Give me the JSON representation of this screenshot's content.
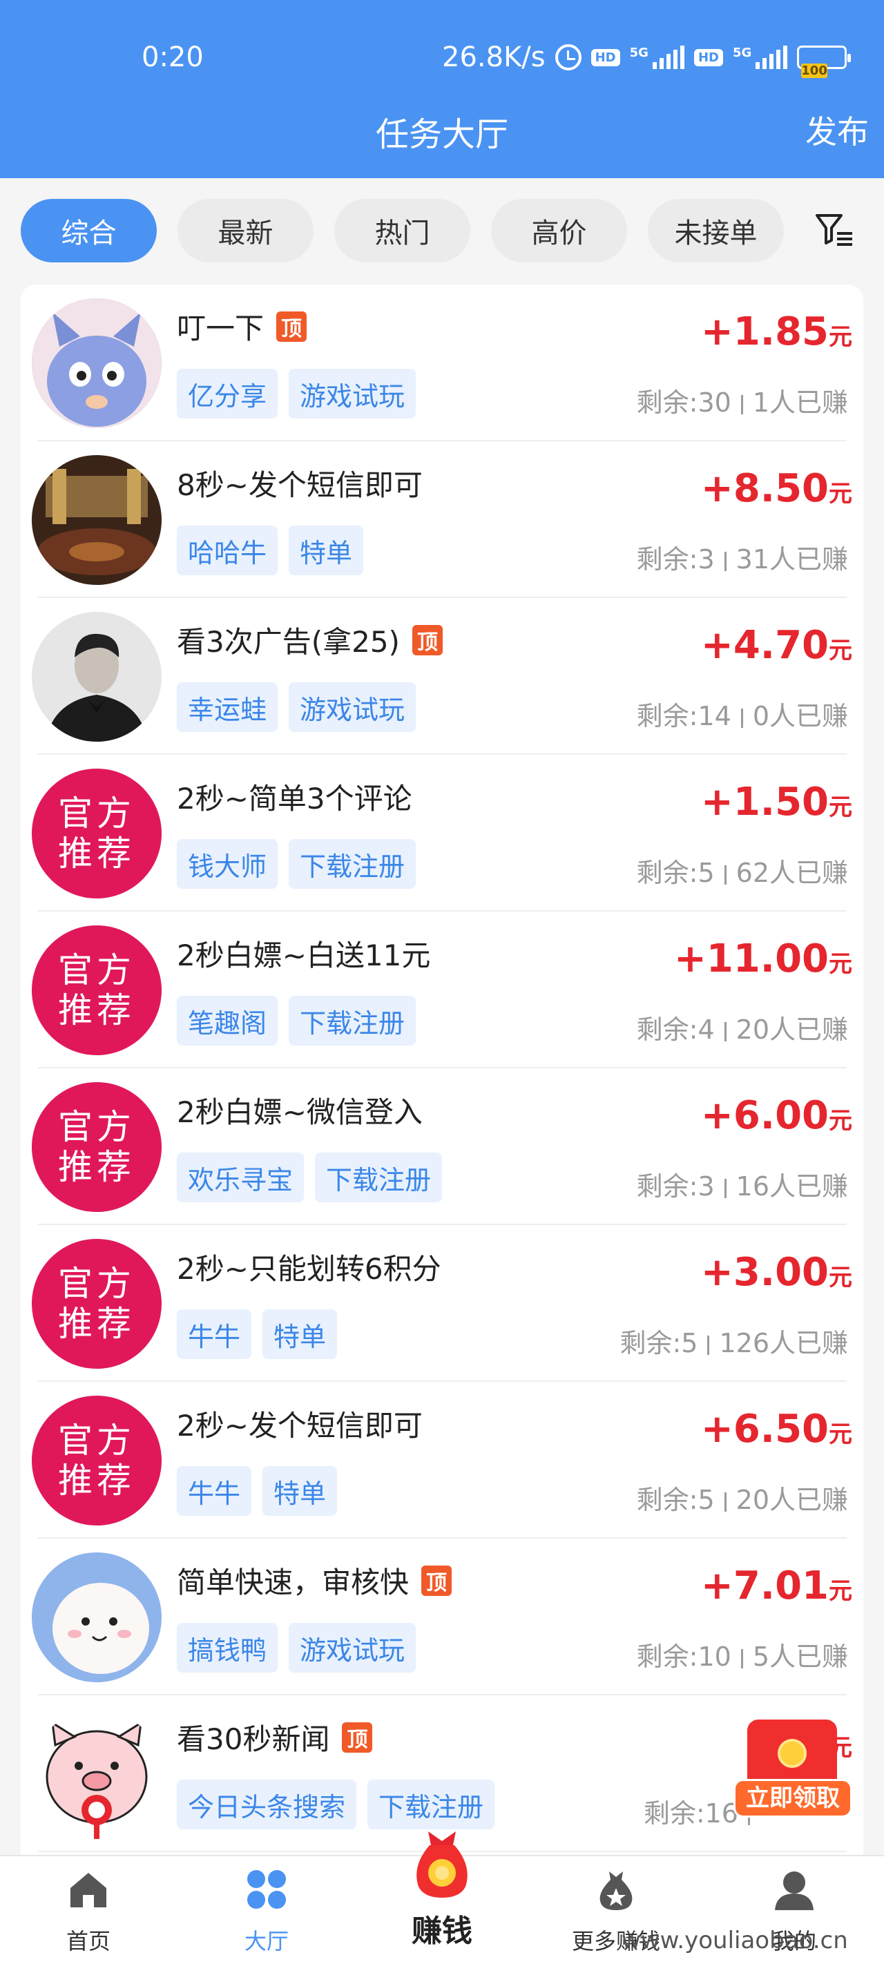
{
  "status_bar": {
    "time": "0:20",
    "speed": "26.8K/s",
    "battery": "100"
  },
  "header": {
    "title": "任务大厅",
    "publish_label": "发布"
  },
  "tabs": [
    {
      "label": "综合",
      "active": true
    },
    {
      "label": "最新",
      "active": false
    },
    {
      "label": "热门",
      "active": false
    },
    {
      "label": "高价",
      "active": false
    },
    {
      "label": "未接单",
      "active": false
    }
  ],
  "tasks": [
    {
      "title": "叮一下",
      "top": true,
      "tags": [
        "亿分享",
        "游戏试玩"
      ],
      "price": "+1.85",
      "unit": "元",
      "remain": "剩余:30",
      "earned": "1人已赚",
      "avatar": "rabbit-avatar"
    },
    {
      "title": "8秒~发个短信即可",
      "top": false,
      "tags": [
        "哈哈牛",
        "特单"
      ],
      "price": "+8.50",
      "unit": "元",
      "remain": "剩余:3",
      "earned": "31人已赚",
      "avatar": "palace-avatar"
    },
    {
      "title": "看3次广告(拿25)",
      "top": true,
      "tags": [
        "幸运蛙",
        "游戏试玩"
      ],
      "price": "+4.70",
      "unit": "元",
      "remain": "剩余:14",
      "earned": "0人已赚",
      "avatar": "man-avatar"
    },
    {
      "title": "2秒~简单3个评论",
      "top": false,
      "tags": [
        "钱大师",
        "下载注册"
      ],
      "price": "+1.50",
      "unit": "元",
      "remain": "剩余:5",
      "earned": "62人已赚",
      "avatar": "official"
    },
    {
      "title": "2秒白嫖~白送11元",
      "top": false,
      "tags": [
        "笔趣阁",
        "下载注册"
      ],
      "price": "+11.00",
      "unit": "元",
      "remain": "剩余:4",
      "earned": "20人已赚",
      "avatar": "official"
    },
    {
      "title": "2秒白嫖~微信登入",
      "top": false,
      "tags": [
        "欢乐寻宝",
        "下载注册"
      ],
      "price": "+6.00",
      "unit": "元",
      "remain": "剩余:3",
      "earned": "16人已赚",
      "avatar": "official"
    },
    {
      "title": "2秒~只能划转6积分",
      "top": false,
      "tags": [
        "牛牛",
        "特单"
      ],
      "price": "+3.00",
      "unit": "元",
      "remain": "剩余:5",
      "earned": "126人已赚",
      "avatar": "official"
    },
    {
      "title": "2秒~发个短信即可",
      "top": false,
      "tags": [
        "牛牛",
        "特单"
      ],
      "price": "+6.50",
      "unit": "元",
      "remain": "剩余:5",
      "earned": "20人已赚",
      "avatar": "official"
    },
    {
      "title": "简单快速，审核快",
      "top": true,
      "tags": [
        "搞钱鸭",
        "游戏试玩"
      ],
      "price": "+7.01",
      "unit": "元",
      "remain": "剩余:10",
      "earned": "5人已赚",
      "avatar": "dog-avatar"
    },
    {
      "title": "看30秒新闻",
      "top": true,
      "tags": [
        "今日头条搜索",
        "下载注册"
      ],
      "price": "+",
      "unit": "元",
      "remain": "剩余:16",
      "earned": "",
      "avatar": "pig-avatar"
    }
  ],
  "official_avatar": {
    "line1": "官方",
    "line2": "推荐"
  },
  "top_badge": "顶",
  "red_packet_label": "立即领取",
  "bottom_nav": {
    "home": "首页",
    "hall": "大厅",
    "earn": "赚钱",
    "more": "更多赚钱",
    "mine": "我的"
  },
  "watermark": "www.youliaobao.cn",
  "colors": {
    "primary": "#4a93f2",
    "price": "#e5262e",
    "official": "#e0185a",
    "tag_bg": "#e8f1fd",
    "tag_text": "#3b86e8"
  }
}
